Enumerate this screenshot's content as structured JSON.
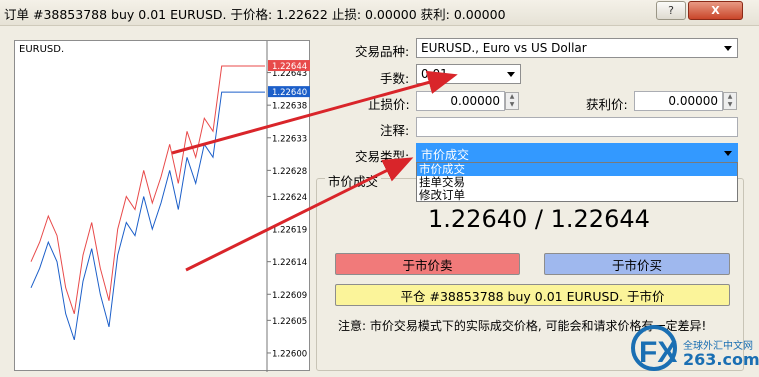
{
  "window": {
    "title": "订单 #38853788 buy 0.01 EURUSD. 于价格: 1.22622 止损: 0.00000 获利: 0.00000",
    "help_label": "?",
    "close_label": "X"
  },
  "chart": {
    "symbol": "EURUSD.",
    "y_ticks": [
      "1.22643",
      "1.22638",
      "1.22633",
      "1.22628",
      "1.22624",
      "1.22619",
      "1.22614",
      "1.22609",
      "1.22605",
      "1.22600"
    ],
    "ask_tag": "1.22644",
    "bid_tag": "1.22640",
    "ask_color": "#e84a4a",
    "bid_color": "#1c5fc9"
  },
  "chart_data": {
    "type": "line",
    "title": "",
    "xlabel": "",
    "ylabel": "",
    "ylim": [
      1.22598,
      1.22646
    ],
    "series": [
      {
        "name": "",
        "values": [
          1.22614,
          1.22617,
          1.22621,
          1.22618,
          1.2261,
          1.22606,
          1.22615,
          1.2262,
          1.22613,
          1.22608,
          1.22619,
          1.22624,
          1.22622,
          1.22628,
          1.22623,
          1.22627,
          1.22632,
          1.22626,
          1.22634,
          1.2263,
          1.22636,
          1.22634,
          1.22644,
          1.22644,
          1.22644,
          1.22644,
          1.22644,
          1.22644
        ]
      },
      {
        "name": "",
        "values": [
          1.2261,
          1.22613,
          1.22617,
          1.22614,
          1.22606,
          1.22602,
          1.22611,
          1.22616,
          1.22609,
          1.22604,
          1.22615,
          1.2262,
          1.22618,
          1.22624,
          1.22619,
          1.22623,
          1.22628,
          1.22622,
          1.2263,
          1.22626,
          1.22632,
          1.2263,
          1.2264,
          1.2264,
          1.2264,
          1.2264,
          1.2264,
          1.2264
        ]
      }
    ]
  },
  "form": {
    "symbol_label": "交易品种:",
    "symbol_value": "EURUSD., Euro vs US Dollar",
    "volume_label": "手数:",
    "volume_value": "0.01",
    "sl_label": "止损价:",
    "sl_value": "0.00000",
    "tp_label": "获利价:",
    "tp_value": "0.00000",
    "comment_label": "注释:",
    "comment_value": "",
    "type_label": "交易类型:",
    "type_value": "市价成交",
    "type_options": [
      "市价成交",
      "挂单交易",
      "修改订单"
    ]
  },
  "execution": {
    "group_title": "市价成交",
    "bid": "1.22640",
    "ask": "1.22644",
    "separator": "/",
    "sell_label": "于市价卖",
    "buy_label": "于市价买",
    "close_label": "平仓 #38853788 buy 0.01 EURUSD. 于市价",
    "note": "注意: 市价交易模式下的实际成交价格, 可能会和请求价格有一定差异!"
  },
  "watermark": {
    "line1": "全球外汇中文网",
    "line2": "263.com"
  }
}
